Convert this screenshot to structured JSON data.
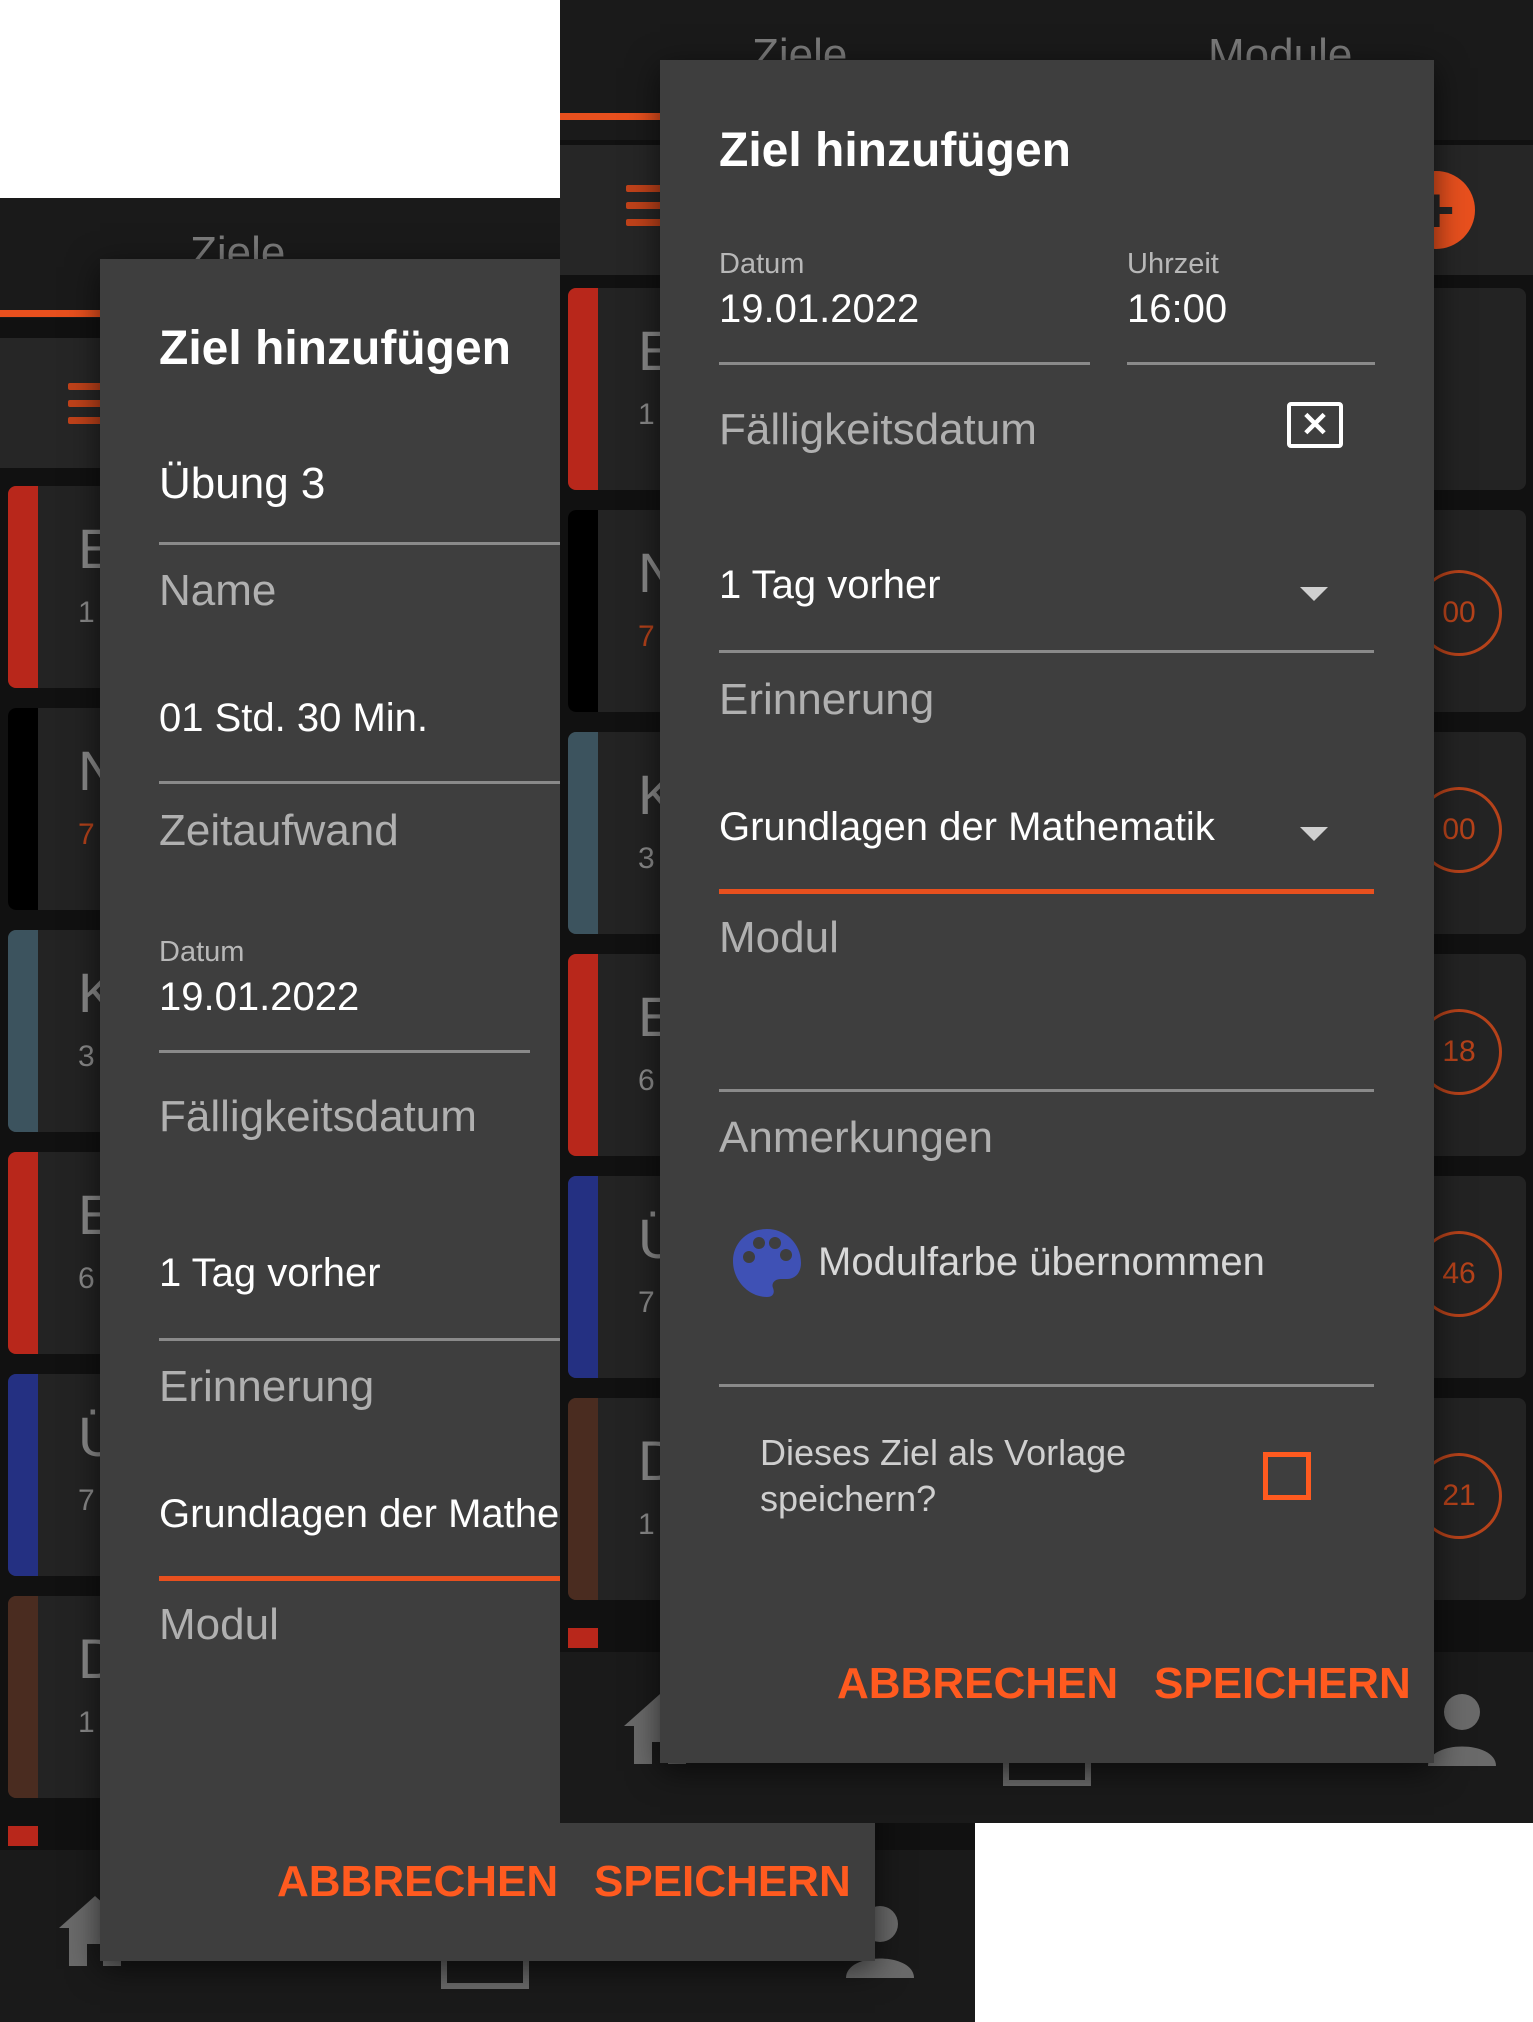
{
  "background_app": {
    "tabs": [
      "Ziele",
      "Module"
    ],
    "cards_left": [
      {
        "letter": "E",
        "sub": "1",
        "color": "#b8271b"
      },
      {
        "letter": "N",
        "sub": "7",
        "color": "#000000"
      },
      {
        "letter": "K",
        "sub": "3",
        "color": "#3c535e"
      },
      {
        "letter": "E",
        "sub": "6",
        "color": "#b8271b"
      },
      {
        "letter": "Ü",
        "sub": "7",
        "color": "#243082"
      },
      {
        "letter": "D",
        "sub": "1",
        "color": "#4a2c20"
      }
    ],
    "cards_right": [
      {
        "letter": "E",
        "sub": "1",
        "color": "#b8271b",
        "badge": ""
      },
      {
        "letter": "N",
        "sub": "7",
        "color": "#000000",
        "badge": "00"
      },
      {
        "letter": "K",
        "sub": "3",
        "color": "#3c535e",
        "badge": "00"
      },
      {
        "letter": "E",
        "sub": "6",
        "color": "#b8271b",
        "badge": "18"
      },
      {
        "letter": "Ü",
        "sub": "7",
        "color": "#243082",
        "badge": "46"
      },
      {
        "letter": "D",
        "sub": "1",
        "color": "#4a2c20",
        "badge": "21"
      }
    ]
  },
  "dialog_left": {
    "title": "Ziel hinzufügen",
    "name_value": "Übung 3",
    "name_label": "Name",
    "effort_value": "01 Std. 30 Min.",
    "effort_label": "Zeitaufwand",
    "date_label": "Datum",
    "date_value": "19.01.2022",
    "due_label": "Fälligkeitsdatum",
    "reminder_value": "1 Tag vorher",
    "reminder_label": "Erinnerung",
    "module_value": "Grundlagen der Mathematik",
    "module_label": "Modul",
    "cancel": "ABBRECHEN",
    "save": "SPEICHERN"
  },
  "dialog_right": {
    "title": "Ziel hinzufügen",
    "date_label": "Datum",
    "date_value": "19.01.2022",
    "time_label": "Uhrzeit",
    "time_value": "16:00",
    "due_label": "Fälligkeitsdatum",
    "reminder_value": "1 Tag vorher",
    "reminder_label": "Erinnerung",
    "module_value": "Grundlagen der Mathematik",
    "module_label": "Modul",
    "notes_label": "Anmerkungen",
    "color_text": "Modulfarbe übernommen",
    "template_text": "Dieses Ziel als Vorlage speichern?",
    "cancel": "ABBRECHEN",
    "save": "SPEICHERN"
  },
  "colors": {
    "accent": "#ff5a1f",
    "dialog_bg": "#3e3e3e",
    "palette_icon": "#3f51b5"
  }
}
